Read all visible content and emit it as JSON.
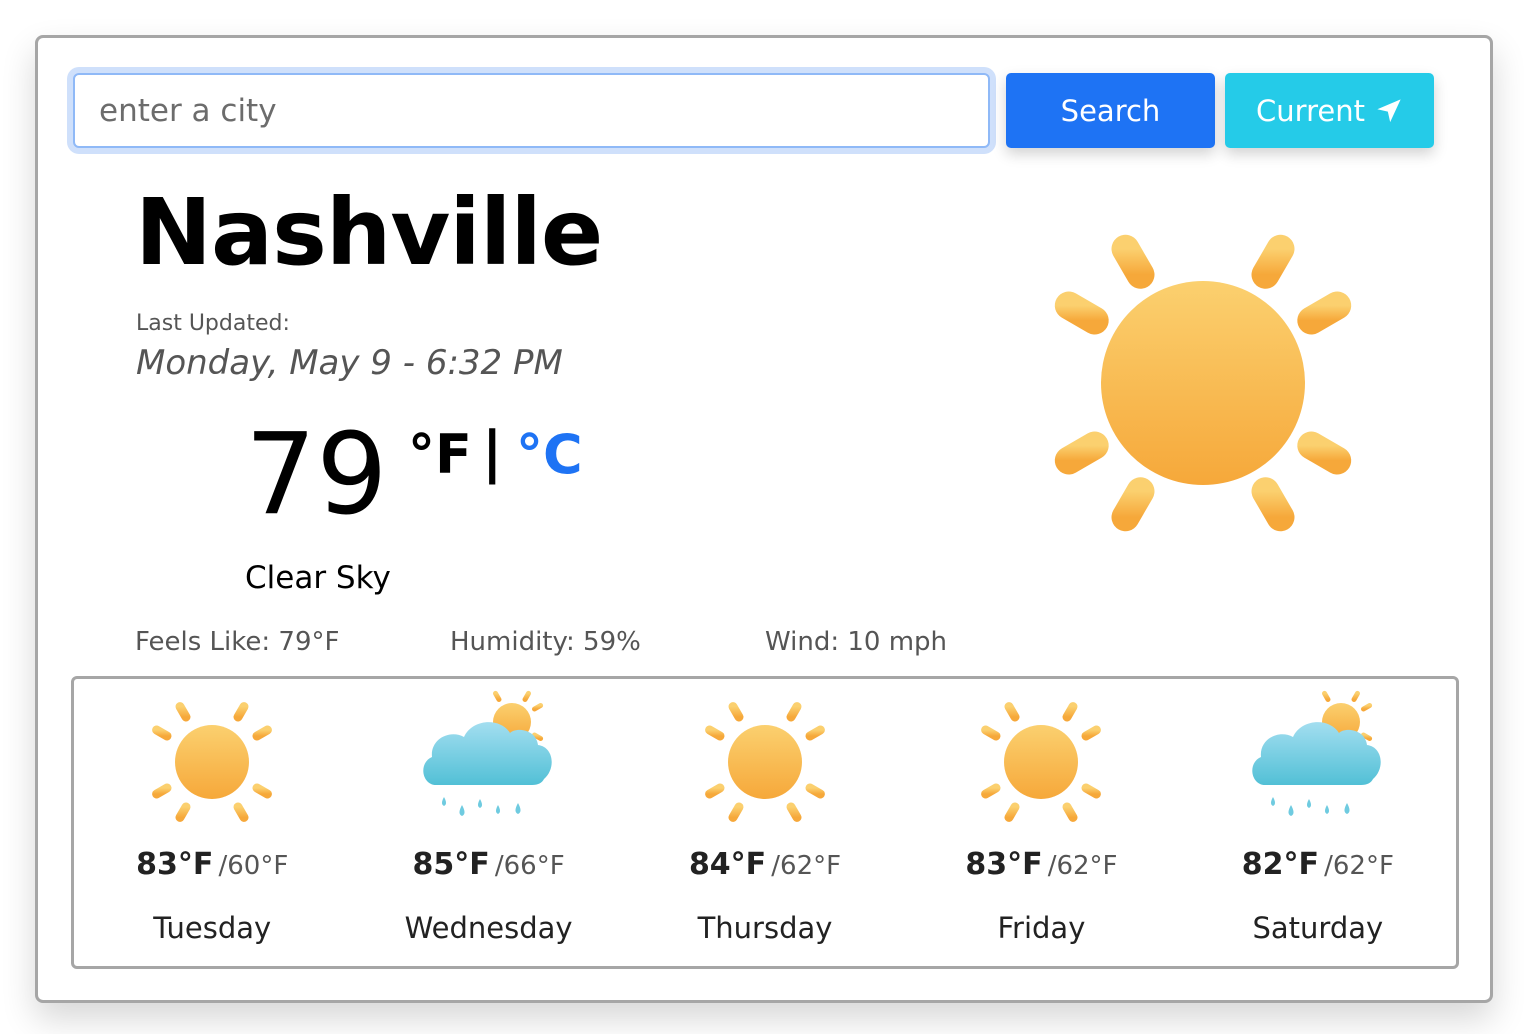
{
  "search": {
    "placeholder": "enter a city",
    "value": ""
  },
  "buttons": {
    "search_label": "Search",
    "current_label": "Current",
    "current_icon": "location-arrow-icon"
  },
  "current": {
    "city": "Nashville",
    "updated_label": "Last Updated:",
    "updated_date": "Monday, May 9 - 6:32 PM",
    "temperature": "79",
    "unit_f": "°F",
    "unit_separator": "|",
    "unit_c": "°C",
    "description": "Clear Sky",
    "icon": "sun-icon",
    "feels_like": "Feels Like: 79°F",
    "humidity": "Humidity: 59%",
    "wind": "Wind: 10 mph"
  },
  "forecast": [
    {
      "day": "Tuesday",
      "max": "83°F",
      "min": "/60°F",
      "icon": "sun-icon"
    },
    {
      "day": "Wednesday",
      "max": "85°F",
      "min": "/66°F",
      "icon": "sun-cloud-rain-icon"
    },
    {
      "day": "Thursday",
      "max": "84°F",
      "min": "/62°F",
      "icon": "sun-icon"
    },
    {
      "day": "Friday",
      "max": "83°F",
      "min": "/62°F",
      "icon": "sun-icon"
    },
    {
      "day": "Saturday",
      "max": "82°F",
      "min": "/62°F",
      "icon": "sun-cloud-rain-icon"
    }
  ],
  "colors": {
    "primary": "#1e73f4",
    "info": "#25cbe8",
    "sun_light": "#fad27a",
    "sun_dark": "#f6a33a",
    "cloud_light": "#9ddcef",
    "cloud_dark": "#52c0d6"
  }
}
